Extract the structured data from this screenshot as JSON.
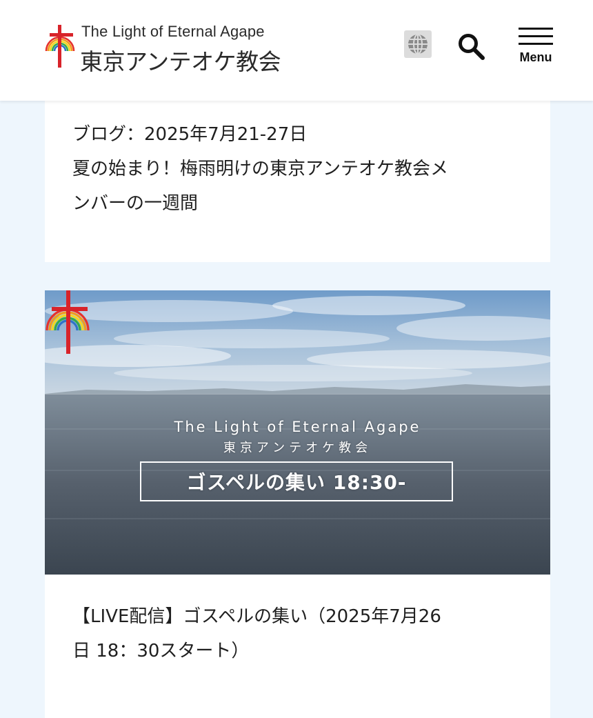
{
  "header": {
    "logo_en": "The Light of Eternal Agape",
    "logo_ja": "東京アンテオケ教会",
    "globe_icon": "globe-icon",
    "search_icon": "search-icon",
    "menu_icon": "hamburger-menu-icon",
    "menu_label": "Menu"
  },
  "posts": [
    {
      "title_line1": "ブログ：2025年7月21-27日",
      "title_line2": "夏の始まり！梅雨明けの東京アンテオケ教会メ",
      "title_line3": "ンバーの一週間"
    },
    {
      "thumbnail": {
        "en": "The Light of Eternal Agape",
        "ja": "東京アンテオケ教会",
        "caption": "ゴスペルの集い 18:30-"
      },
      "title_line1": "【LIVE配信】ゴスペルの集い（2025年7月26",
      "title_line2": "日 18：30スタート）"
    }
  ],
  "colors": {
    "page_background": "#eef6fd",
    "card_background": "#ffffff",
    "cross_red": "#d8232a",
    "text": "#1f1f1f"
  }
}
